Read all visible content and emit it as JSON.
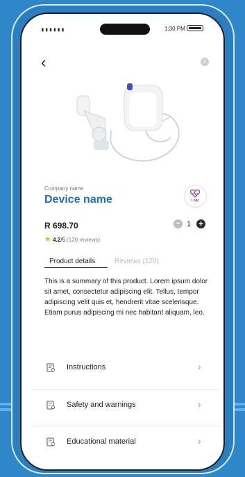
{
  "status_bar": {
    "signal": "▮▮▮▮▮▮",
    "time": "1:30 PM"
  },
  "product": {
    "company": "Company name",
    "device": "Device name",
    "logo_label": "Logo",
    "price": "R 698.70",
    "quantity": "1",
    "rating_score": "4.2",
    "rating_max": "/5",
    "rating_count": "(120 reviews)"
  },
  "tabs": {
    "details": "Product details",
    "reviews": "Reviews (120)"
  },
  "summary": "This is a summary of this product. Lorem ipsum dolor sit amet, consectetur adipiscing elit. Tellus, tempor adipiscing velit quis et, hendrerit vitae scelerisque. Etiam purus adipiscing mi nec habitant aliquam, leo.",
  "menu": {
    "instructions": "Instructions",
    "safety": "Safety and warnings",
    "educational": "Educational material"
  },
  "colors": {
    "accent": "#1f6fc0",
    "background": "#2f86c9",
    "logo": "#a03a9c"
  },
  "icons": {
    "back": "chevron-left-icon",
    "info": "info-icon",
    "star": "star-icon",
    "minus": "minus-icon",
    "plus": "plus-icon",
    "document": "document-icon",
    "chevron": "chevron-right-icon"
  }
}
